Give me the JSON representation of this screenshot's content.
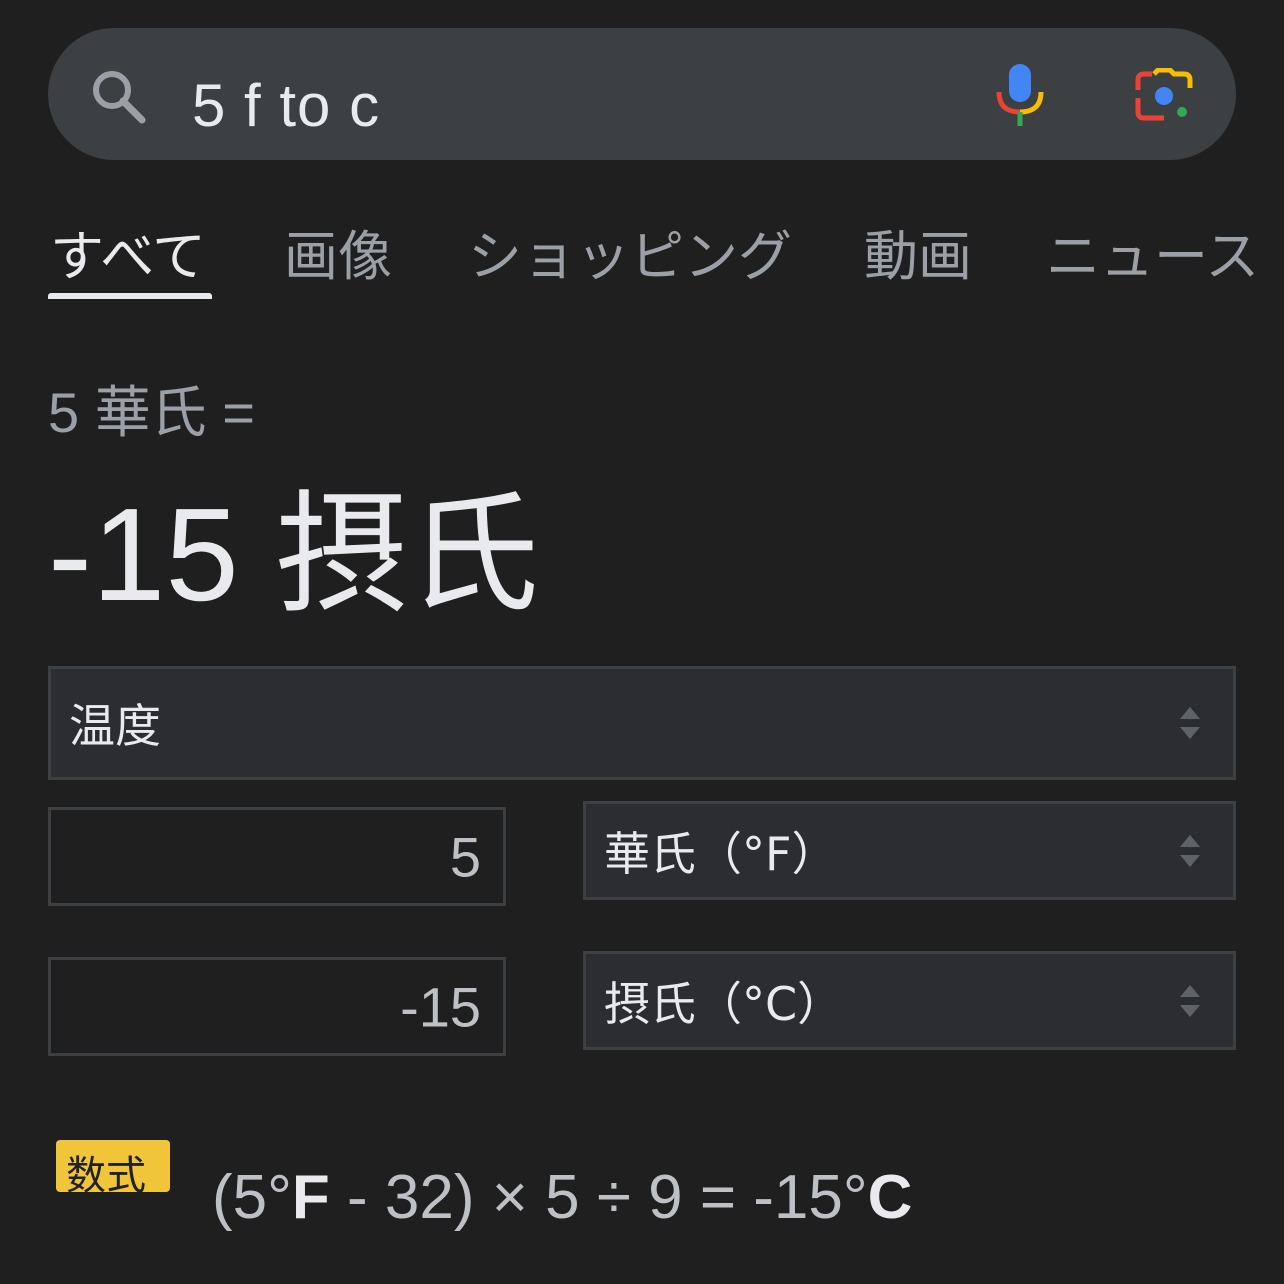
{
  "search": {
    "query": "5 f to c",
    "icons": [
      "search-icon",
      "mic-icon",
      "lens-icon"
    ]
  },
  "tabs": [
    {
      "label": "すべて",
      "active": true
    },
    {
      "label": "画像",
      "active": false
    },
    {
      "label": "ショッピング",
      "active": false
    },
    {
      "label": "動画",
      "active": false
    },
    {
      "label": "ニュース",
      "active": false
    }
  ],
  "result": {
    "input_line": "5 華氏 =",
    "output_line": "-15 摂氏"
  },
  "converter": {
    "category": "温度",
    "from_value": "5",
    "from_unit": "華氏（°F）",
    "to_value": "-15",
    "to_unit": "摂氏（°C）"
  },
  "formula": {
    "badge": "数式",
    "open": "(5°",
    "unit_f": "F",
    "middle": " - 32) × 5 ÷ 9 = -15°",
    "unit_c": "C"
  },
  "colors": {
    "background": "#1f1f1f",
    "search_bar": "#3c4043",
    "badge": "#f0c53a",
    "mic_blue": "#4285f4",
    "mic_red": "#ea4335",
    "mic_yellow": "#fbbc04",
    "mic_green": "#34a853"
  }
}
